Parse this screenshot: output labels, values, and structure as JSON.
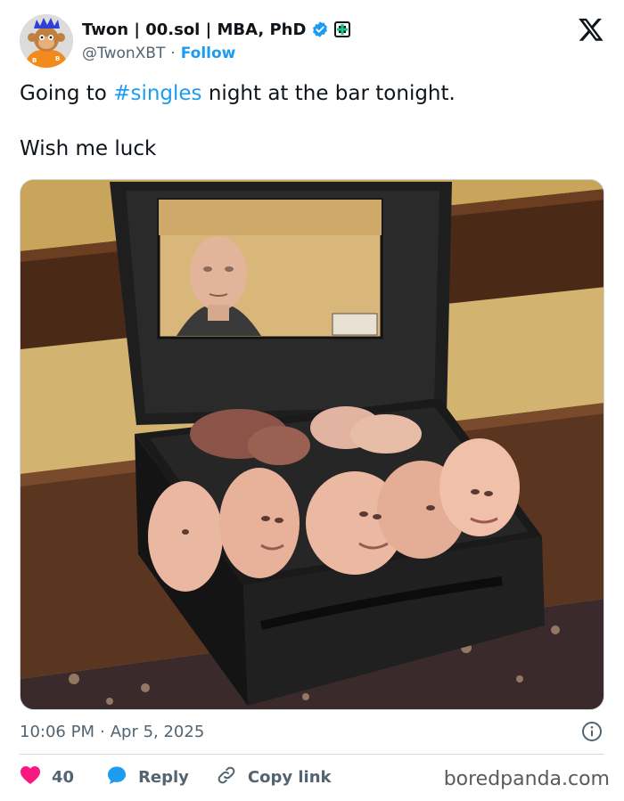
{
  "tweet": {
    "author": {
      "display_name": "Twon | 00.sol | MBA, PhD",
      "handle": "@TwonXBT",
      "verified": true,
      "follow_label": "Follow",
      "separator": "·"
    },
    "text": {
      "prefix": "Going to ",
      "hashtag": "#singles",
      "suffix": " night at the bar tonight.",
      "line2": "Wish me luck"
    },
    "media": {
      "kind": "photo"
    },
    "timestamp": {
      "time": "10:06 PM",
      "separator": "·",
      "date": "Apr 5, 2025"
    },
    "actions": {
      "likes": "40",
      "reply_label": "Reply",
      "copy_link_label": "Copy link"
    }
  },
  "watermark": "boredpanda.com",
  "colors": {
    "link_blue": "#1d9bf0",
    "like_red": "#f91880",
    "muted_text": "#536471",
    "primary_text": "#0f1419"
  },
  "icons": {
    "logo": "x-logo-icon",
    "verified": "verified-badge-icon",
    "affiliate": "affiliate-badge-icon",
    "like": "heart-icon",
    "reply": "speech-bubble-icon",
    "copy_link": "link-icon",
    "info": "info-icon"
  }
}
